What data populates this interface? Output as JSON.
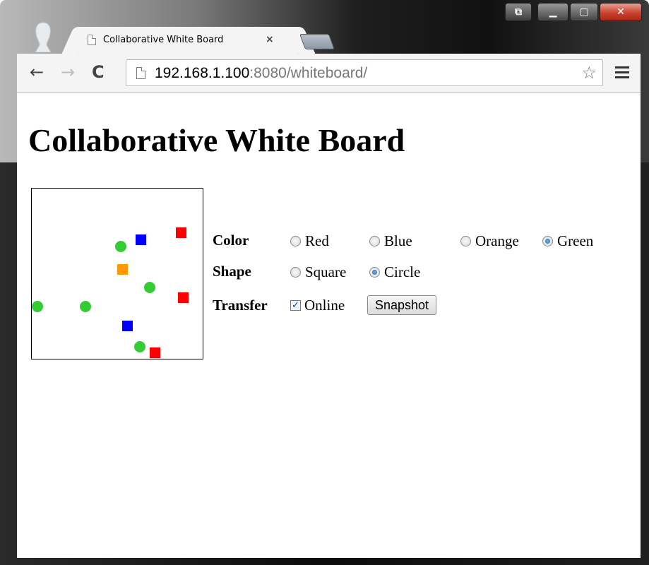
{
  "window": {
    "controls": [
      "extension-icon",
      "minimize-icon",
      "maximize-icon",
      "close-icon"
    ]
  },
  "tab": {
    "title": "Collaborative White Board",
    "close_glyph": "×"
  },
  "toolbar": {
    "back_glyph": "←",
    "forward_glyph": "→",
    "reload_glyph": "C",
    "url_host": "192.168.1.100",
    "url_rest": ":8080/whiteboard/",
    "star_glyph": "☆"
  },
  "page": {
    "heading": "Collaborative White Board"
  },
  "controls": {
    "color": {
      "label": "Color",
      "options": [
        "Red",
        "Blue",
        "Orange",
        "Green"
      ],
      "selected": "Green"
    },
    "shape": {
      "label": "Shape",
      "options": [
        "Square",
        "Circle"
      ],
      "selected": "Circle"
    },
    "transfer": {
      "label": "Transfer",
      "online_label": "Online",
      "online_checked": true,
      "snapshot_label": "Snapshot"
    }
  },
  "palette": {
    "red": "#ff0000",
    "blue": "#0000ff",
    "orange": "#ff9900",
    "green": "#33cc33"
  },
  "board_shapes": [
    {
      "shape": "square",
      "color": "red"
    },
    {
      "shape": "square",
      "color": "blue"
    },
    {
      "shape": "circle",
      "color": "green"
    },
    {
      "shape": "square",
      "color": "orange"
    },
    {
      "shape": "circle",
      "color": "green"
    },
    {
      "shape": "square",
      "color": "red"
    },
    {
      "shape": "circle",
      "color": "green"
    },
    {
      "shape": "circle",
      "color": "green"
    },
    {
      "shape": "square",
      "color": "blue"
    },
    {
      "shape": "circle",
      "color": "green"
    },
    {
      "shape": "square",
      "color": "red"
    }
  ]
}
